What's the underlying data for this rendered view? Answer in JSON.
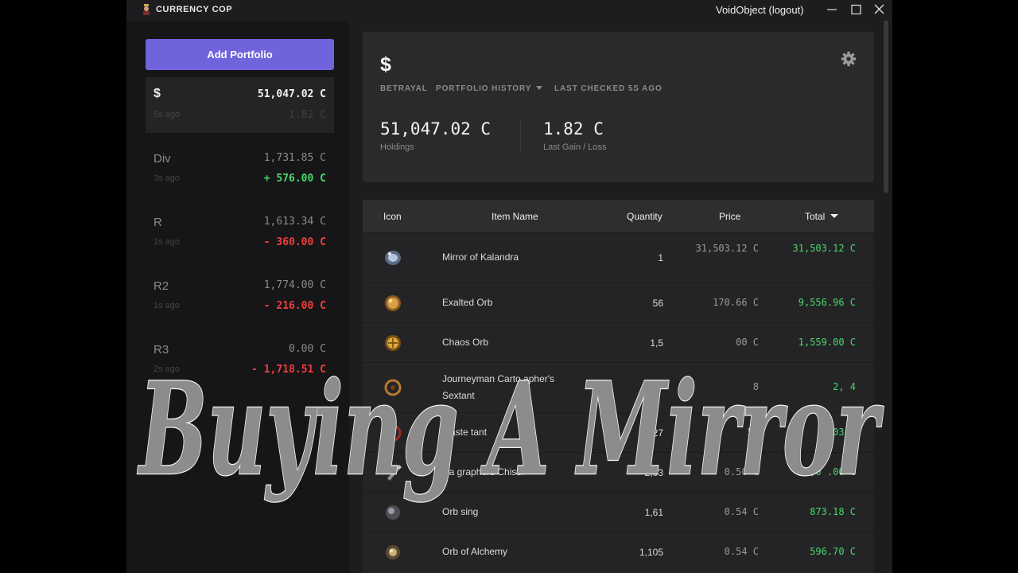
{
  "app": {
    "title": "CURRENCY COP",
    "user_label": "VoidObject (logout)"
  },
  "icons": {
    "logo": "currency-cop-logo-icon",
    "minimize": "minimize-icon",
    "maximize": "maximize-icon",
    "close": "close-icon",
    "settings": "gear-icon",
    "sort": "caret-down-icon"
  },
  "colors": {
    "accent": "#6f64db",
    "gain": "#4ad86a",
    "loss": "#f13d3d",
    "background": "#1d1d1f",
    "sidebar": "#161618",
    "card": "#2a2a2c"
  },
  "sidebar": {
    "add_button": "Add Portfolio",
    "portfolios": [
      {
        "name": "$",
        "value": "51,047.02 C",
        "ago": "5s ago",
        "gain": "1.82 C",
        "trend": "muted",
        "active": true
      },
      {
        "name": "Div",
        "value": "1,731.85 C",
        "ago": "3s ago",
        "gain": "+ 576.00 C",
        "trend": "pos",
        "active": false
      },
      {
        "name": "R",
        "value": "1,613.34 C",
        "ago": "1s ago",
        "gain": "- 360.00 C",
        "trend": "neg",
        "active": false
      },
      {
        "name": "R2",
        "value": "1,774.00 C",
        "ago": "1s ago",
        "gain": "- 216.00 C",
        "trend": "neg",
        "active": false
      },
      {
        "name": "R3",
        "value": "0.00 C",
        "ago": "2s ago",
        "gain": "- 1,718.51 C",
        "trend": "neg",
        "active": false
      }
    ]
  },
  "summary": {
    "symbol": "$",
    "league": "BETRAYAL",
    "history_label": "PORTFOLIO HISTORY",
    "last_checked": "LAST CHECKED 5S AGO",
    "holdings_value": "51,047.02 C",
    "holdings_label": "Holdings",
    "gain_value": "1.82 C",
    "gain_label": "Last Gain / Loss"
  },
  "table": {
    "columns": [
      "Icon",
      "Item Name",
      "Quantity",
      "Price",
      "Total"
    ],
    "sorted_by": "Total",
    "rows": [
      {
        "icon": "mirror-of-kalandra-icon",
        "name": "Mirror of Kalandra",
        "quantity": "1",
        "price": "31,503.12 C",
        "total": "31,503.12 C"
      },
      {
        "icon": "exalted-orb-icon",
        "name": "Exalted Orb",
        "quantity": "56",
        "price": "170.66 C",
        "total": "9,556.96 C"
      },
      {
        "icon": "chaos-orb-icon",
        "name": "Chaos Orb",
        "quantity": "1,5",
        "price": "00 C",
        "total": "1,559.00 C"
      },
      {
        "icon": "sextant-icon",
        "name": "Journeyman Carto apher's Sextant",
        "quantity": "67",
        "price": "8",
        "total": "2, 4"
      },
      {
        "icon": "sextant-icon",
        "name": "Maste tant",
        "quantity": "27",
        "price": "55",
        "total": "1,03 5"
      },
      {
        "icon": "cartographers-chisel-icon",
        "name": "Ca graphers Chisel",
        "quantity": "2,03",
        "price": "0.50 C",
        "total": "1,0 .00 C"
      },
      {
        "icon": "orb-of-fusing-icon",
        "name": "Orb sing",
        "quantity": "1,61",
        "price": "0.54 C",
        "total": "873.18 C"
      },
      {
        "icon": "orb-of-alchemy-icon",
        "name": "Orb of Alchemy",
        "quantity": "1,105",
        "price": "0.54 C",
        "total": "596.70 C"
      }
    ]
  },
  "overlay": {
    "text": "Buying A Mirror"
  }
}
